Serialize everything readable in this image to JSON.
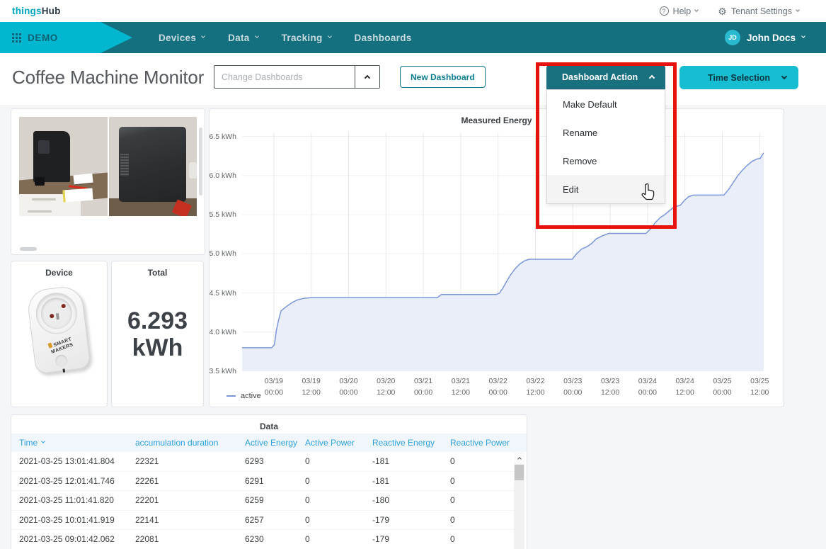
{
  "topbar": {
    "brand_teal": "things",
    "brand_dark": "Hub",
    "help": "Help",
    "tenant_settings": "Tenant Settings"
  },
  "navbar": {
    "tenant": "DEMO",
    "items": [
      {
        "label": "Devices",
        "caret": true
      },
      {
        "label": "Data",
        "caret": true
      },
      {
        "label": "Tracking",
        "caret": true
      },
      {
        "label": "Dashboards",
        "caret": false
      }
    ],
    "user_initials": "JD",
    "user_name": "John Docs"
  },
  "toolbar": {
    "page_title": "Coffee Machine Monitor",
    "change_dashboards_placeholder": "Change Dashboards",
    "new_dashboard": "New Dashboard",
    "dashboard_action": "Dashboard Action",
    "time_selection": "Time Selection",
    "dashboard_action_menu": [
      "Make Default",
      "Rename",
      "Remove",
      "Edit"
    ],
    "hovered_menu_item": "Edit"
  },
  "device_card": {
    "title": "Device",
    "plug_brand_line1": "SMART",
    "plug_brand_line2": "MAKERS"
  },
  "total_card": {
    "title": "Total",
    "value": "6.293",
    "unit": "kWh"
  },
  "data_table": {
    "title": "Data",
    "sorted_column": "Time",
    "columns": [
      "Time",
      "accumulation duration",
      "Active Energy",
      "Active Power",
      "Reactive Energy",
      "Reactive Power"
    ],
    "rows": [
      [
        "2021-03-25 13:01:41.804",
        "22321",
        "6293",
        "0",
        "-181",
        "0"
      ],
      [
        "2021-03-25 12:01:41.746",
        "22261",
        "6291",
        "0",
        "-181",
        "0"
      ],
      [
        "2021-03-25 11:01:41.820",
        "22201",
        "6259",
        "0",
        "-180",
        "0"
      ],
      [
        "2021-03-25 10:01:41.919",
        "22141",
        "6257",
        "0",
        "-179",
        "0"
      ],
      [
        "2021-03-25 09:01:42.062",
        "22081",
        "6230",
        "0",
        "-179",
        "0"
      ]
    ]
  },
  "colors": {
    "accent_cyan": "#00b7cf",
    "navbar_teal": "#14707f",
    "action_button_teal": "#19707f",
    "time_selection_cyan": "#17bed2",
    "annotation_red": "#e8120c",
    "table_header_blue": "#2ea2dc",
    "chart_line_blue": "#7b97d9"
  },
  "chart_data": {
    "type": "area",
    "title": "Measured Energy",
    "xlabel": "",
    "ylabel": "kWh",
    "grid": true,
    "legend_position": "bottom-left",
    "x_axis_start": "2021-03-19 00:00",
    "xlim_hours": [
      -10.2,
      157.3
    ],
    "ylim": [
      3.5,
      6.55
    ],
    "y_tick_values": [
      6.5,
      6.0,
      5.5,
      5.0,
      4.5,
      4.0,
      3.5
    ],
    "y_tick_labels": [
      "6.5 kWh",
      "6.0 kWh",
      "5.5 kWh",
      "5.0 kWh",
      "4.5 kWh",
      "4.0 kWh",
      "3.5 kWh"
    ],
    "x_tick_hours": [
      0,
      12,
      24,
      36,
      48,
      60,
      72,
      84,
      96,
      108,
      120,
      132,
      144,
      156
    ],
    "x_tick_labels": [
      [
        "03/19",
        "00:00"
      ],
      [
        "03/19",
        "12:00"
      ],
      [
        "03/20",
        "00:00"
      ],
      [
        "03/20",
        "12:00"
      ],
      [
        "03/21",
        "00:00"
      ],
      [
        "03/21",
        "12:00"
      ],
      [
        "03/22",
        "00:00"
      ],
      [
        "03/22",
        "12:00"
      ],
      [
        "03/23",
        "00:00"
      ],
      [
        "03/23",
        "12:00"
      ],
      [
        "03/24",
        "00:00"
      ],
      [
        "03/24",
        "12:00"
      ],
      [
        "03/25",
        "00:00"
      ],
      [
        "03/25",
        "12:00"
      ]
    ],
    "series": [
      {
        "name": "active",
        "color": "#7b97d9",
        "fill": "#e9eef9",
        "points": [
          [
            -10.2,
            3.8
          ],
          [
            -0.7,
            3.8
          ],
          [
            0.2,
            3.84
          ],
          [
            0.8,
            4.02
          ],
          [
            1.5,
            4.15
          ],
          [
            2.3,
            4.27
          ],
          [
            3.2,
            4.3
          ],
          [
            4.5,
            4.34
          ],
          [
            6.0,
            4.38
          ],
          [
            7.5,
            4.41
          ],
          [
            9.5,
            4.43
          ],
          [
            12.0,
            4.44
          ],
          [
            52.5,
            4.44
          ],
          [
            53.8,
            4.48
          ],
          [
            71.5,
            4.48
          ],
          [
            72.5,
            4.5
          ],
          [
            73.5,
            4.56
          ],
          [
            74.5,
            4.63
          ],
          [
            76.0,
            4.73
          ],
          [
            77.5,
            4.81
          ],
          [
            79.0,
            4.87
          ],
          [
            80.5,
            4.91
          ],
          [
            82.0,
            4.93
          ],
          [
            95.8,
            4.93
          ],
          [
            97.2,
            5.0
          ],
          [
            98.8,
            5.06
          ],
          [
            100.5,
            5.09
          ],
          [
            102.0,
            5.13
          ],
          [
            103.5,
            5.19
          ],
          [
            105.5,
            5.23
          ],
          [
            107.5,
            5.26
          ],
          [
            119.5,
            5.26
          ],
          [
            121.0,
            5.32
          ],
          [
            122.5,
            5.4
          ],
          [
            124.0,
            5.46
          ],
          [
            125.5,
            5.5
          ],
          [
            127.0,
            5.55
          ],
          [
            128.5,
            5.6
          ],
          [
            130.5,
            5.62
          ],
          [
            131.8,
            5.68
          ],
          [
            133.2,
            5.73
          ],
          [
            134.8,
            5.75
          ],
          [
            144.5,
            5.75
          ],
          [
            146.0,
            5.82
          ],
          [
            147.5,
            5.91
          ],
          [
            149.0,
            6.0
          ],
          [
            150.5,
            6.07
          ],
          [
            152.0,
            6.13
          ],
          [
            153.5,
            6.18
          ],
          [
            155.0,
            6.21
          ],
          [
            156.2,
            6.22
          ],
          [
            156.8,
            6.26
          ],
          [
            157.3,
            6.29
          ]
        ]
      }
    ]
  }
}
